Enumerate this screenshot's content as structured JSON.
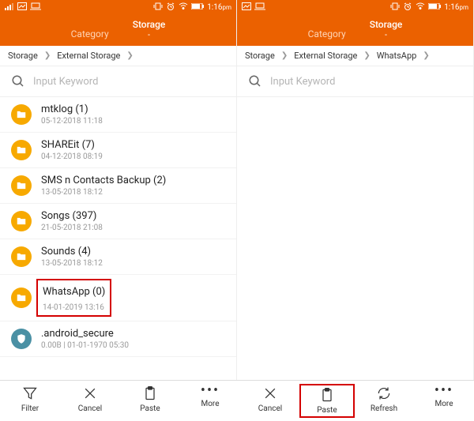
{
  "status": {
    "time": "1:16",
    "ampm": "pm"
  },
  "tabs": {
    "category": "Category",
    "storage": "Storage",
    "dash": "-"
  },
  "breadcrumb_left": [
    "Storage",
    "External Storage"
  ],
  "breadcrumb_right": [
    "Storage",
    "External Storage",
    "WhatsApp"
  ],
  "search": {
    "placeholder": "Input Keyword"
  },
  "items": [
    {
      "title": "mtklog (1)",
      "sub": "05-12-2018 11:18"
    },
    {
      "title": "SHAREit (7)",
      "sub": "04-12-2018 08:19"
    },
    {
      "title": "SMS n Contacts Backup (2)",
      "sub": "13-05-2018 18:12"
    },
    {
      "title": "Songs (397)",
      "sub": "21-05-2018 21:08"
    },
    {
      "title": "Sounds (4)",
      "sub": "13-05-2018 18:12"
    },
    {
      "title": "WhatsApp (0)",
      "sub": "14-01-2019 13:16"
    },
    {
      "title": ".android_secure",
      "sub": "0.00B | 01-01-1970 05:30"
    }
  ],
  "bottom": {
    "filter": "Filter",
    "cancel": "Cancel",
    "paste": "Paste",
    "more": "More",
    "refresh": "Refresh"
  }
}
